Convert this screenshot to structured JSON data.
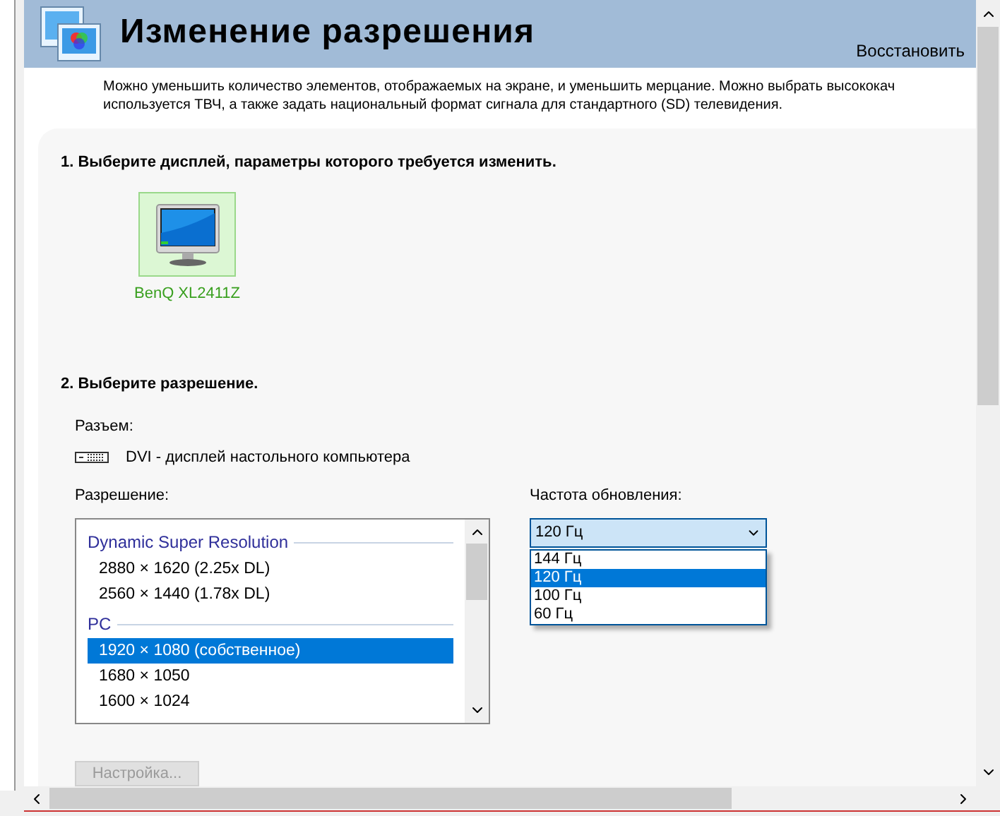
{
  "header": {
    "title": "Изменение разрешения",
    "restore_link": "Восстановить"
  },
  "description": [
    "Можно уменьшить количество элементов, отображаемых на экране, и уменьшить мерцание. Можно выбрать высококач",
    "используется ТВЧ, а также задать национальный формат сигнала для стандартного (SD) телевидения."
  ],
  "step1": {
    "heading": "1. Выберите дисплей, параметры которого требуется изменить.",
    "displays": [
      {
        "name": "BenQ XL2411Z",
        "selected": true
      }
    ]
  },
  "step2": {
    "heading": "2. Выберите разрешение.",
    "connector_label": "Разъем:",
    "connector": "DVI - дисплей настольного компьютера",
    "resolution_label": "Разрешение:",
    "resolutions": [
      {
        "kind": "group",
        "label": "Dynamic Super Resolution"
      },
      {
        "kind": "item",
        "label": "2880 × 1620 (2.25x DL)",
        "selected": false
      },
      {
        "kind": "item",
        "label": "2560 × 1440 (1.78x DL)",
        "selected": false
      },
      {
        "kind": "group",
        "label": "PC"
      },
      {
        "kind": "item",
        "label": "1920 × 1080 (собственное)",
        "selected": true
      },
      {
        "kind": "item",
        "label": "1680 × 1050",
        "selected": false
      },
      {
        "kind": "item",
        "label": "1600 × 1024",
        "selected": false
      }
    ],
    "refresh_label": "Частота обновления:",
    "refresh_value": "120 Гц",
    "refresh_expanded": true,
    "refresh_options": [
      {
        "label": "144 Гц",
        "selected": false
      },
      {
        "label": "120 Гц",
        "selected": true
      },
      {
        "label": "100 Гц",
        "selected": false
      },
      {
        "label": "60 Гц",
        "selected": false
      }
    ],
    "customize_button": {
      "label": "Настройка...",
      "disabled": true
    }
  }
}
